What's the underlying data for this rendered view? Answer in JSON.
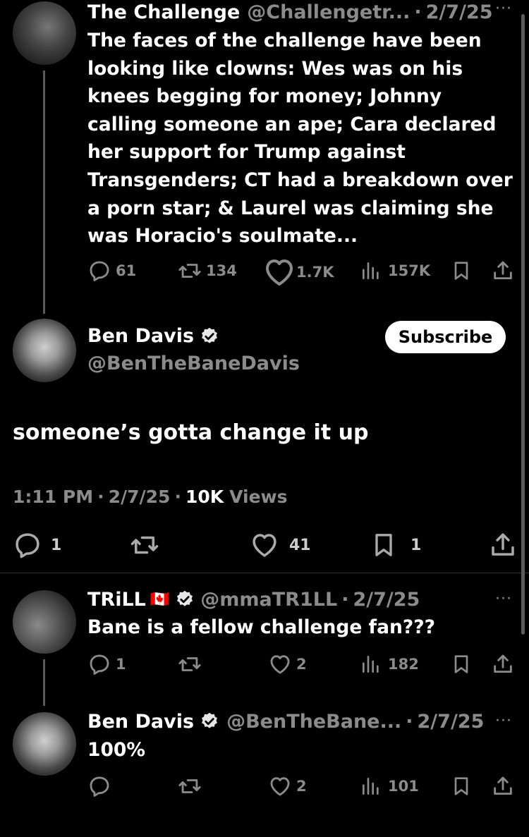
{
  "tweet1": {
    "name": "The Challenge",
    "handle": "@Challengetr...",
    "date": "2/7/25",
    "text": "The faces of the challenge have been looking like clowns: Wes was on his knees begging for money; Johnny calling someone an ape; Cara declared her support for Trump against Transgenders; CT had a breakdown over a porn star; & Laurel was claiming she was Horacio's soulmate...",
    "replies": "61",
    "retweets": "134",
    "likes": "1.7K",
    "views": "157K"
  },
  "main": {
    "name": "Ben Davis",
    "handle": "@BenTheBaneDavis",
    "subscribe_label": "Subscribe",
    "text": "someone’s gotta change it up",
    "time": "1:11 PM",
    "date": "2/7/25",
    "views_count": "10K",
    "views_label": "Views",
    "replies": "1",
    "likes": "41",
    "bookmarks": "1"
  },
  "reply1": {
    "name": "TRiLL",
    "flag": "🇨🇦",
    "handle": "@mmaTR1LL",
    "date": "2/7/25",
    "text": "Bane is a fellow challenge fan???",
    "replies": "1",
    "likes": "2",
    "views": "182"
  },
  "reply2": {
    "name": "Ben Davis",
    "handle": "@BenTheBane...",
    "date": "2/7/25",
    "text": "100%",
    "likes": "2",
    "views": "101"
  },
  "colors": {
    "background": "#000000",
    "muted": "#8b8b8b",
    "text": "#ffffff"
  },
  "icons": [
    "reply-icon",
    "retweet-icon",
    "like-icon",
    "views-icon",
    "bookmark-icon",
    "share-icon",
    "verified-icon",
    "more-icon"
  ]
}
